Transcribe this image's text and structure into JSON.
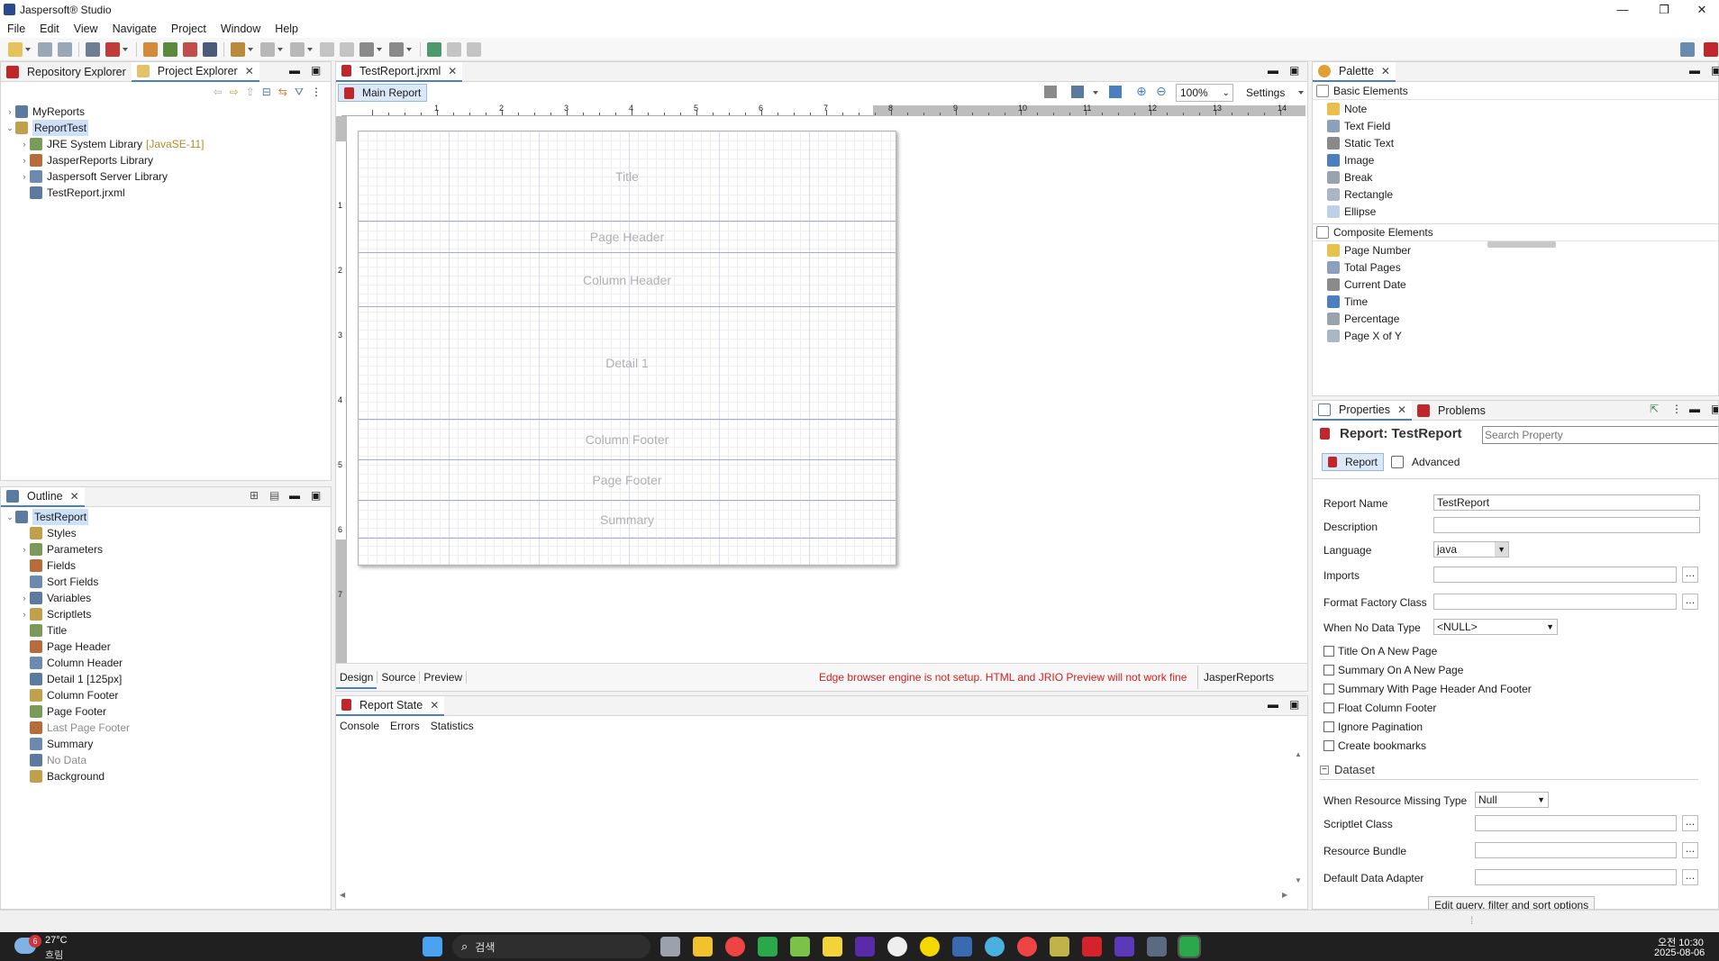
{
  "window": {
    "title": "Jaspersoft® Studio",
    "controls": [
      "—",
      "❐",
      "✕"
    ]
  },
  "menu": [
    "File",
    "Edit",
    "View",
    "Navigate",
    "Project",
    "Window",
    "Help"
  ],
  "left_top": {
    "tabs": [
      {
        "label": "Repository Explorer"
      },
      {
        "label": "Project Explorer"
      }
    ],
    "tree": [
      {
        "label": "MyReports",
        "indent": 0,
        "caret": "›"
      },
      {
        "label": "ReportTest",
        "indent": 0,
        "caret": "⌄",
        "selected": true
      },
      {
        "label": "JRE System Library",
        "suffix": "[JavaSE-11]",
        "indent": 1,
        "caret": "›"
      },
      {
        "label": "JasperReports Library",
        "indent": 1,
        "caret": "›"
      },
      {
        "label": "Jaspersoft Server Library",
        "indent": 1,
        "caret": "›"
      },
      {
        "label": "TestReport.jrxml",
        "indent": 1,
        "caret": ""
      }
    ]
  },
  "outline": {
    "tab": "Outline",
    "items": [
      {
        "label": "TestReport",
        "indent": 0,
        "caret": "⌄",
        "selected": true
      },
      {
        "label": "Styles",
        "indent": 1,
        "caret": ""
      },
      {
        "label": "Parameters",
        "indent": 1,
        "caret": "›"
      },
      {
        "label": "Fields",
        "indent": 1,
        "caret": ""
      },
      {
        "label": "Sort Fields",
        "indent": 1,
        "caret": ""
      },
      {
        "label": "Variables",
        "indent": 1,
        "caret": "›"
      },
      {
        "label": "Scriptlets",
        "indent": 1,
        "caret": "›"
      },
      {
        "label": "Title",
        "indent": 1,
        "caret": ""
      },
      {
        "label": "Page Header",
        "indent": 1,
        "caret": ""
      },
      {
        "label": "Column Header",
        "indent": 1,
        "caret": ""
      },
      {
        "label": "Detail 1 [125px]",
        "indent": 1,
        "caret": ""
      },
      {
        "label": "Column Footer",
        "indent": 1,
        "caret": ""
      },
      {
        "label": "Page Footer",
        "indent": 1,
        "caret": ""
      },
      {
        "label": "Last Page Footer",
        "indent": 1,
        "caret": "",
        "muted": true
      },
      {
        "label": "Summary",
        "indent": 1,
        "caret": ""
      },
      {
        "label": "No Data",
        "indent": 1,
        "caret": "",
        "muted": true
      },
      {
        "label": "Background",
        "indent": 1,
        "caret": ""
      }
    ]
  },
  "editor": {
    "tab": "TestReport.jrxml",
    "subtab": "Main Report",
    "zoom": "100%",
    "settings": "Settings",
    "ruler_numbers": [
      "1",
      "2",
      "3",
      "4",
      "5",
      "6",
      "7",
      "8",
      "9",
      "10",
      "11",
      "12",
      "13",
      "14"
    ],
    "vruler_numbers": [
      "1",
      "2",
      "3",
      "4",
      "5",
      "6",
      "7"
    ],
    "bands": [
      {
        "label": "Title",
        "h": 100
      },
      {
        "label": "Page Header",
        "h": 35
      },
      {
        "label": "Column Header",
        "h": 60
      },
      {
        "label": "Detail 1",
        "h": 125
      },
      {
        "label": "Column Footer",
        "h": 45
      },
      {
        "label": "Page Footer",
        "h": 45
      },
      {
        "label": "Summary",
        "h": 42
      }
    ],
    "bottom_tabs": [
      "Design",
      "Source",
      "Preview"
    ],
    "warning": "Edge browser engine is not setup. HTML and JRIO Preview will not work fine",
    "library": "JasperReports Library"
  },
  "report_state": {
    "tab": "Report State",
    "subtabs": [
      "Console",
      "Errors",
      "Statistics"
    ]
  },
  "palette": {
    "tab": "Palette",
    "basic_title": "Basic Elements",
    "basic": [
      "Note",
      "Text Field",
      "Static Text",
      "Image",
      "Break",
      "Rectangle",
      "Ellipse"
    ],
    "composite_title": "Composite Elements",
    "composite": [
      "Page Number",
      "Total Pages",
      "Current Date",
      "Time",
      "Percentage",
      "Page X of Y"
    ]
  },
  "properties": {
    "tabs": [
      "Properties",
      "Problems"
    ],
    "header": "Report: TestReport",
    "search_placeholder": "Search Property",
    "subtabs": [
      "Report",
      "Advanced"
    ],
    "report_name_label": "Report Name",
    "report_name": "TestReport",
    "description_label": "Description",
    "language_label": "Language",
    "language": "java",
    "imports_label": "Imports",
    "format_factory_label": "Format Factory Class",
    "no_data_label": "When No Data Type",
    "no_data": "<NULL>",
    "checkboxes": [
      "Title On A New Page",
      "Summary On A New Page",
      "Summary With Page Header And Footer",
      "Float Column Footer",
      "Ignore Pagination",
      "Create bookmarks"
    ],
    "dataset_title": "Dataset",
    "missing_label": "When Resource Missing Type",
    "missing": "Null",
    "scriptlet_label": "Scriptlet Class",
    "bundle_label": "Resource Bundle",
    "adapter_label": "Default Data Adapter",
    "edit_query": "Edit query, filter and sort options"
  },
  "taskbar": {
    "weather_temp": "27°C",
    "weather_desc": "흐림",
    "weather_badge": "6",
    "search": "검색",
    "time": "오전 10:30",
    "date": "2025-08-06"
  }
}
